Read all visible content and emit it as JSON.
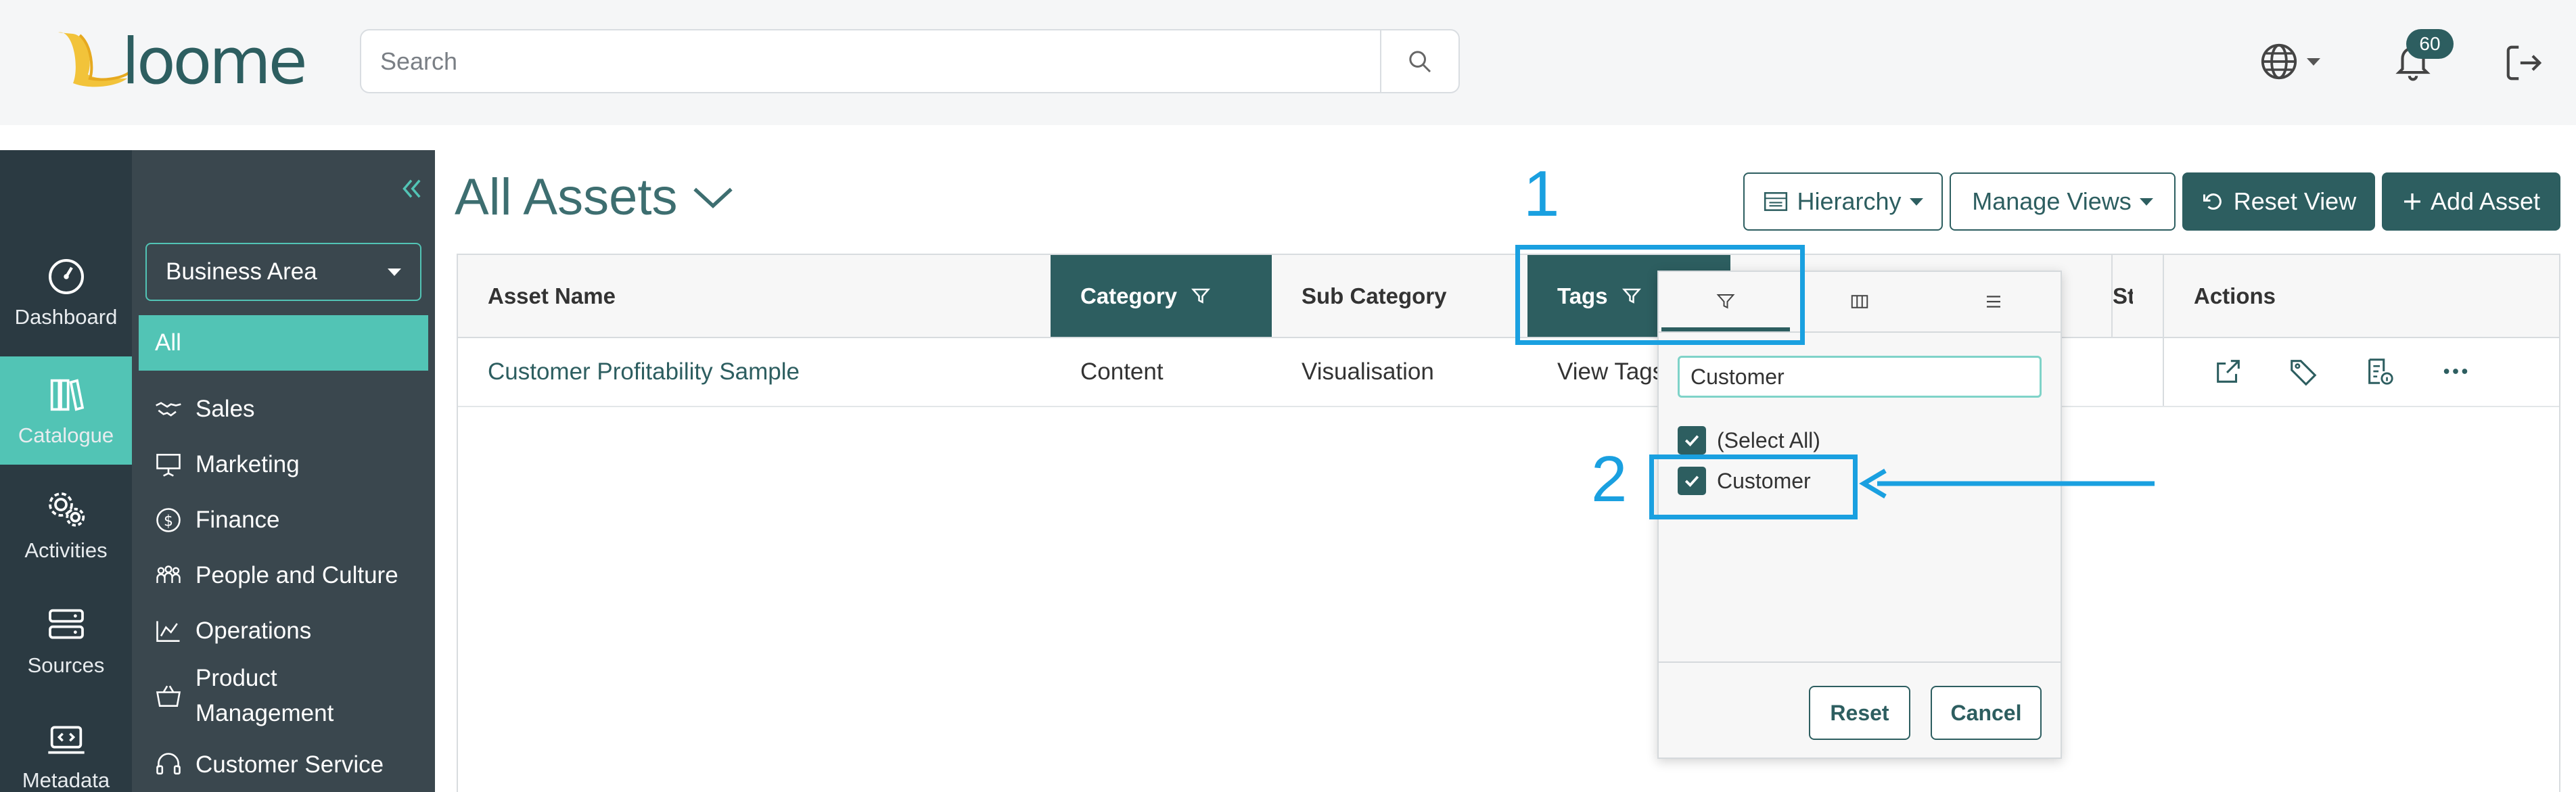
{
  "header": {
    "logo_text": "loome",
    "search_placeholder": "Search",
    "notification_count": "60"
  },
  "rail": {
    "items": [
      {
        "label": "Dashboard",
        "icon": "dashboard-icon"
      },
      {
        "label": "Catalogue",
        "icon": "catalogue-icon",
        "active": true
      },
      {
        "label": "Activities",
        "icon": "activities-icon"
      },
      {
        "label": "Sources",
        "icon": "sources-icon"
      },
      {
        "label": "Metadata",
        "icon": "metadata-icon"
      }
    ]
  },
  "areas": {
    "select_label": "Business Area",
    "items": [
      {
        "label": "All",
        "active": true
      },
      {
        "label": "Sales",
        "icon": "handshake-icon"
      },
      {
        "label": "Marketing",
        "icon": "presentation-icon"
      },
      {
        "label": "Finance",
        "icon": "dollar-icon"
      },
      {
        "label": "People and Culture",
        "icon": "people-icon"
      },
      {
        "label": "Operations",
        "icon": "chart-icon"
      },
      {
        "label": "Product",
        "label2": "Management",
        "icon": "basket-icon"
      },
      {
        "label": "Customer Service",
        "icon": "headset-icon"
      }
    ]
  },
  "main": {
    "title": "All Assets",
    "buttons": {
      "hierarchy": "Hierarchy",
      "manage_views": "Manage Views",
      "reset_view": "Reset View",
      "add_asset": "Add Asset"
    },
    "columns": {
      "asset_name": "Asset Name",
      "category": "Category",
      "sub_category": "Sub Category",
      "tags": "Tags",
      "status_partial": "St",
      "actions": "Actions"
    },
    "rows": [
      {
        "asset_name": "Customer Profitability Sample",
        "category": "Content",
        "sub_category": "Visualisation",
        "tags": "View Tags"
      }
    ]
  },
  "filter_popup": {
    "filter_value": "Customer",
    "options": [
      {
        "label": "(Select All)",
        "checked": true
      },
      {
        "label": "Customer",
        "checked": true
      }
    ],
    "reset_label": "Reset",
    "cancel_label": "Cancel"
  },
  "annotations": {
    "step1": "1",
    "step2": "2",
    "color": "#1aa0e0"
  },
  "colors": {
    "brand_dark": "#2d5e60",
    "accent": "#52c4b5",
    "rail_bg": "#2b3a42",
    "sidebar_bg": "#3a474e"
  }
}
